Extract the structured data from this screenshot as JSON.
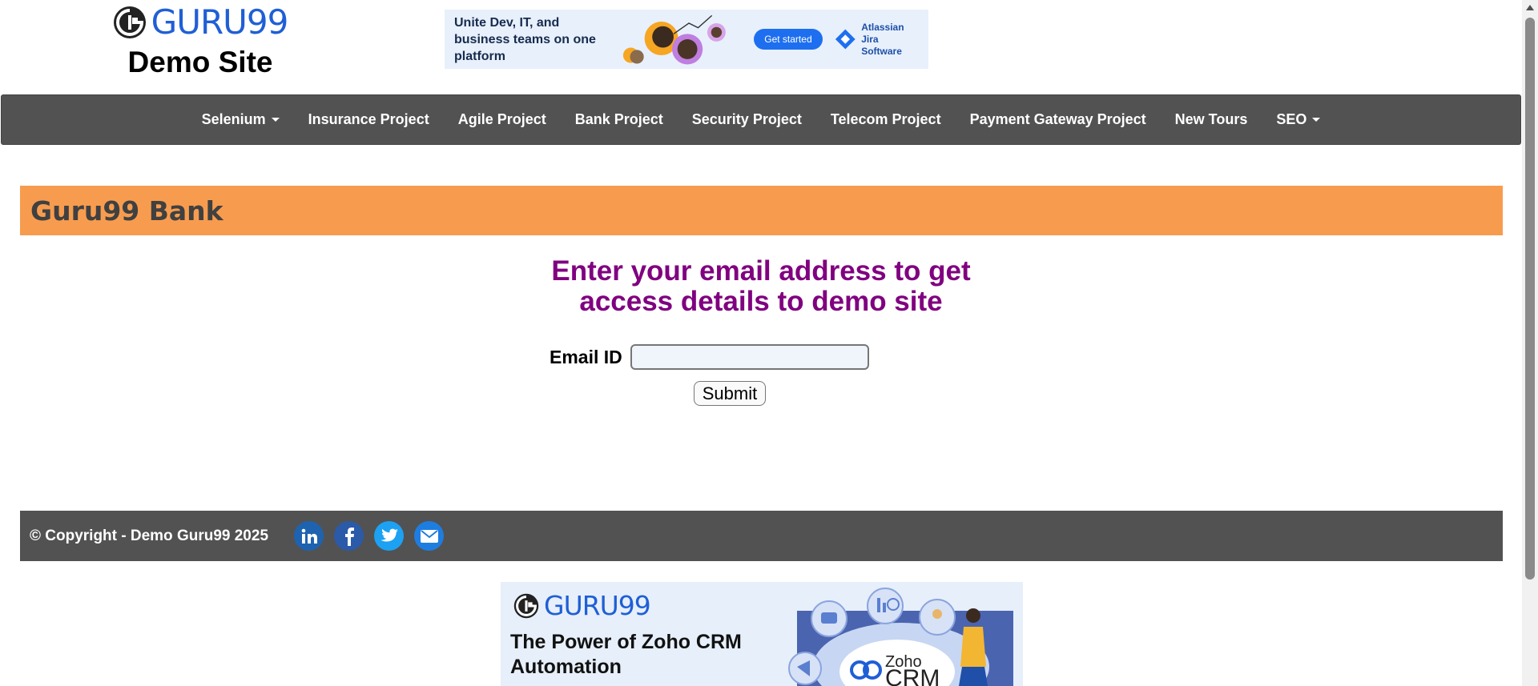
{
  "header": {
    "logo_text": "GURU99",
    "logo_subtitle": "Demo Site"
  },
  "top_ad": {
    "text": "Unite Dev, IT, and business teams on one platform",
    "cta": "Get started",
    "brand_line1": "Atlassian",
    "brand_line2": "Jira Software"
  },
  "nav": {
    "items": [
      {
        "label": "Selenium",
        "dropdown": true
      },
      {
        "label": "Insurance Project",
        "dropdown": false
      },
      {
        "label": "Agile Project",
        "dropdown": false
      },
      {
        "label": "Bank Project",
        "dropdown": false
      },
      {
        "label": "Security Project",
        "dropdown": false
      },
      {
        "label": "Telecom Project",
        "dropdown": false
      },
      {
        "label": "Payment Gateway Project",
        "dropdown": false
      },
      {
        "label": "New Tours",
        "dropdown": false
      },
      {
        "label": "SEO",
        "dropdown": true
      }
    ]
  },
  "banner": {
    "title": "Guru99 Bank"
  },
  "form": {
    "heading_line1": "Enter your email address to get",
    "heading_line2": "access details to demo site",
    "email_label": "Email ID",
    "email_value": "",
    "email_placeholder": "",
    "submit_label": "Submit"
  },
  "footer": {
    "copyright": "© Copyright - Demo Guru99 2025",
    "social": [
      {
        "name": "linkedin-icon",
        "color": "#1e63b0"
      },
      {
        "name": "facebook-icon",
        "color": "#2b5aa8"
      },
      {
        "name": "twitter-icon",
        "color": "#1da1f2"
      },
      {
        "name": "email-icon",
        "color": "#1e7de0"
      }
    ]
  },
  "bottom_ad": {
    "logo_text": "GURU99",
    "headline": "The Power of Zoho CRM Automation",
    "product_line1": "Zoho",
    "product_line2": "CRM"
  },
  "colors": {
    "nav_bg": "#525252",
    "banner_bg": "#f79c4f",
    "heading": "#800080",
    "logo_blue": "#1f5fd6"
  }
}
